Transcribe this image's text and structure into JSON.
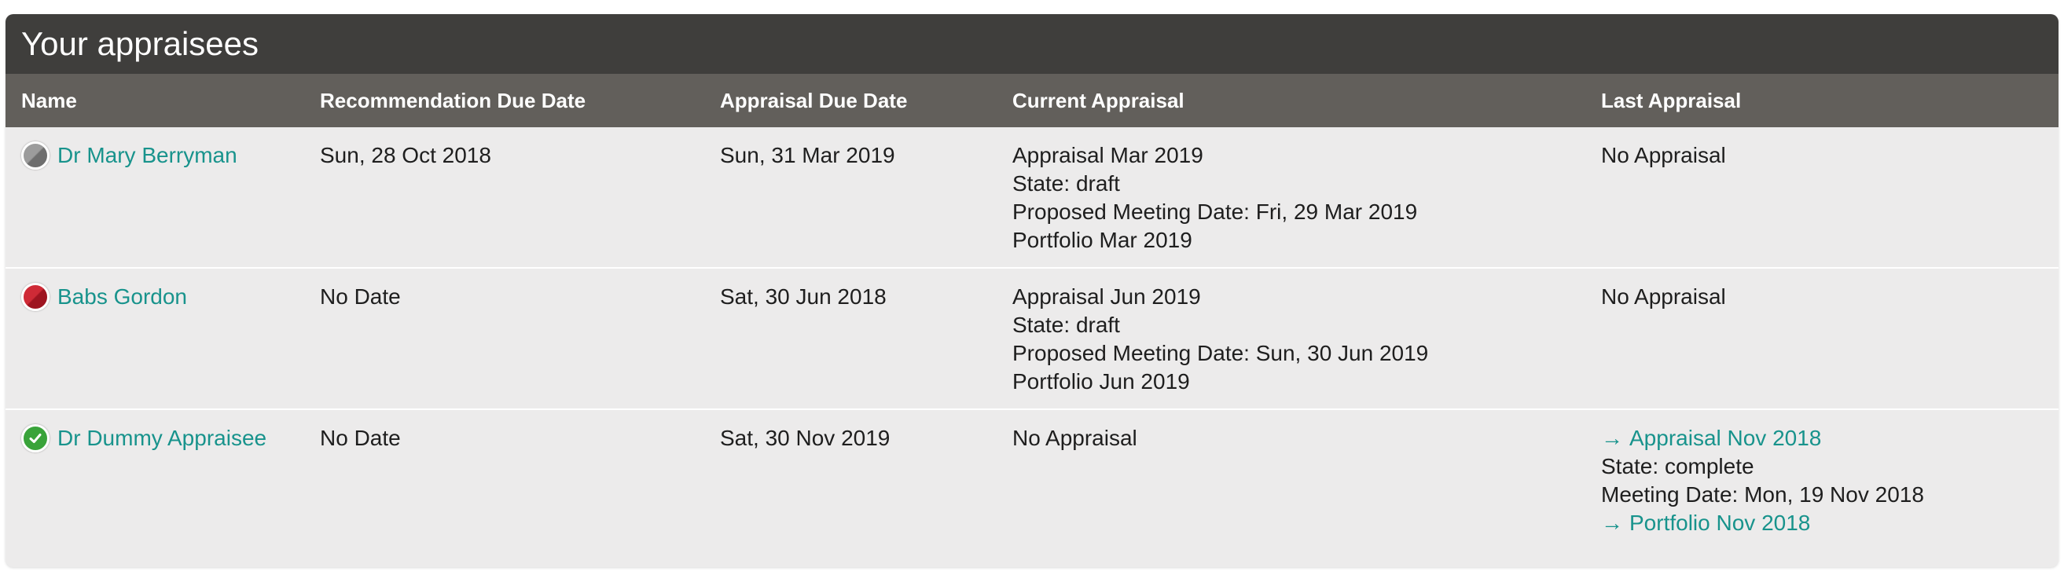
{
  "panel": {
    "title": "Your appraisees"
  },
  "table": {
    "headers": [
      "Name",
      "Recommendation Due Date",
      "Appraisal Due Date",
      "Current Appraisal",
      "Last Appraisal"
    ],
    "rows": [
      {
        "status": "grey",
        "name": "Dr Mary Berryman",
        "recommendation_due": "Sun, 28 Oct 2018",
        "appraisal_due": "Sun, 31 Mar 2019",
        "current": [
          "Appraisal Mar 2019",
          "State: draft",
          "Proposed Meeting Date: Fri, 29 Mar 2019",
          "Portfolio Mar 2019"
        ],
        "last": [
          "No Appraisal"
        ]
      },
      {
        "status": "red",
        "name": "Babs Gordon",
        "recommendation_due": "No Date",
        "appraisal_due": "Sat, 30 Jun 2018",
        "current": [
          "Appraisal Jun 2019",
          "State: draft",
          "Proposed Meeting Date: Sun, 30 Jun 2019",
          "Portfolio Jun 2019"
        ],
        "last": [
          "No Appraisal"
        ]
      },
      {
        "status": "complete",
        "name": "Dr Dummy Appraisee",
        "recommendation_due": "No Date",
        "appraisal_due": "Sat, 30 Nov 2019",
        "current": [
          "No Appraisal"
        ],
        "last": [
          "Appraisal Nov 2018",
          "State: complete",
          "Meeting Date: Mon, 19 Nov 2018",
          "Portfolio Nov 2018"
        ]
      }
    ]
  },
  "icons": {
    "arrow": "→",
    "check": "✔"
  },
  "colors": {
    "header_bg": "#3f3e3c",
    "subheader_bg": "#625f5b",
    "link": "#18938c",
    "status_red": "#cf2a36",
    "status_grey": "#8a8a8a",
    "status_green": "#39a33a"
  }
}
